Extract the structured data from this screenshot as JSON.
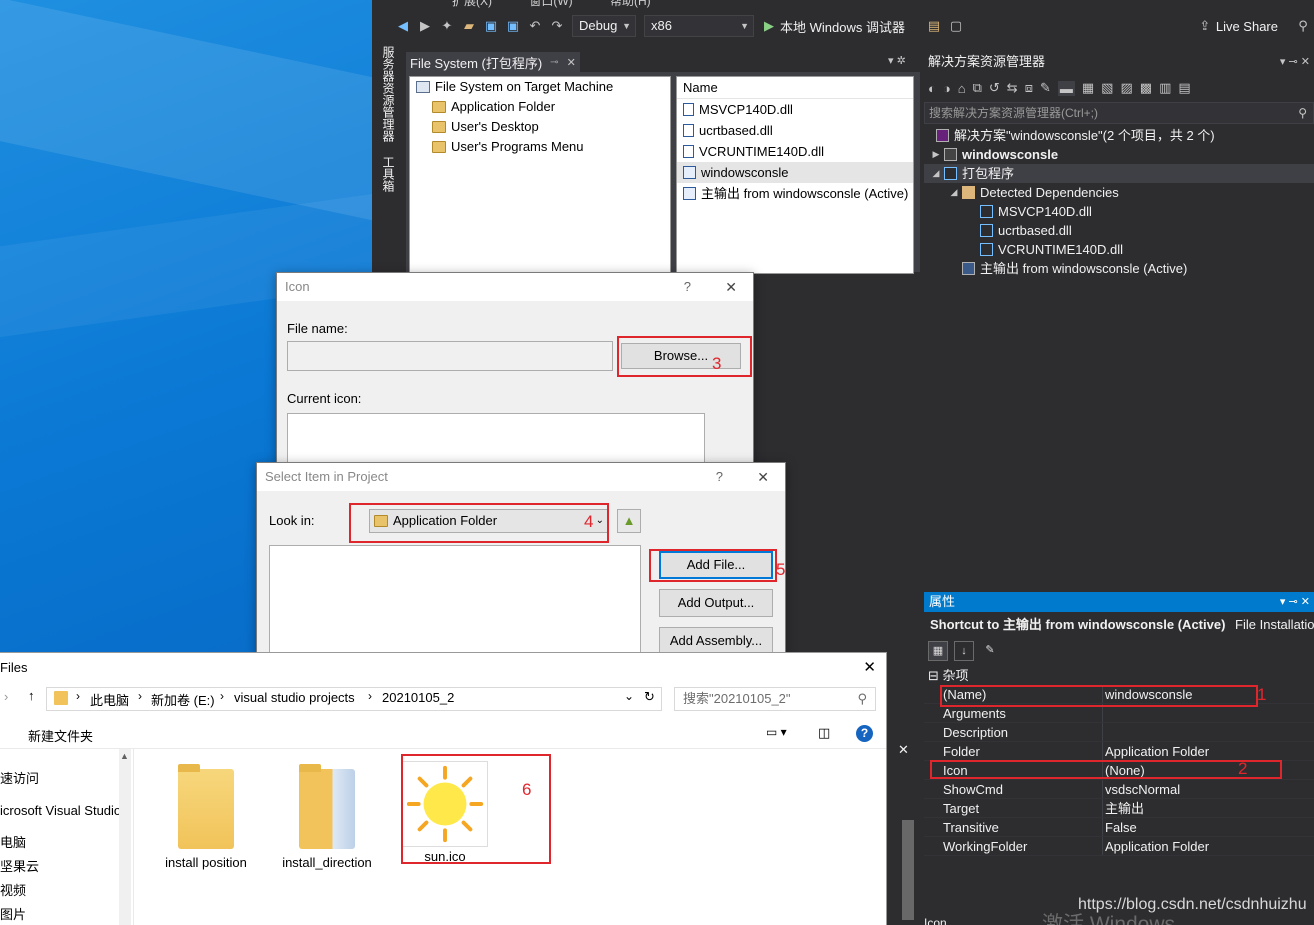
{
  "vs": {
    "menu_remnants": [
      "扩展(X)",
      "窗口(W)",
      "帮助(H)"
    ],
    "toolbar": {
      "config": "Debug",
      "platform": "x86",
      "run_label": "本地 Windows 调试器",
      "live_share": "Live Share"
    },
    "side_tabs": [
      "服务器资源管理器",
      "工具箱"
    ],
    "fs_window": {
      "tab_title": "File System (打包程序)",
      "tree": [
        "File System on Target Machine",
        "Application Folder",
        "User's Desktop",
        "User's Programs Menu"
      ],
      "list_header": "Name",
      "list_items": [
        "MSVCP140D.dll",
        "ucrtbased.dll",
        "VCRUNTIME140D.dll",
        "windowsconsle",
        "主输出 from windowsconsle (Active)"
      ]
    },
    "solution_explorer": {
      "title": "解决方案资源管理器",
      "search_placeholder": "搜索解决方案资源管理器(Ctrl+;)",
      "items": [
        "解决方案\"windowsconsle\"(2 个项目，共 2 个)",
        "windowsconsle",
        "打包程序",
        "Detected Dependencies",
        "MSVCP140D.dll",
        "ucrtbased.dll",
        "VCRUNTIME140D.dll",
        "主输出 from windowsconsle (Active)"
      ]
    },
    "properties": {
      "title": "属性",
      "object_name": "Shortcut to 主输出 from windowsconsle (Active)",
      "object_type": "File Installation",
      "category": "杂项",
      "rows": [
        {
          "k": "(Name)",
          "v": "windowsconsle"
        },
        {
          "k": "Arguments",
          "v": ""
        },
        {
          "k": "Description",
          "v": ""
        },
        {
          "k": "Folder",
          "v": "Application Folder"
        },
        {
          "k": "Icon",
          "v": "(None)"
        },
        {
          "k": "ShowCmd",
          "v": "vsdscNormal"
        },
        {
          "k": "Target",
          "v": "主输出"
        },
        {
          "k": "Transitive",
          "v": "False"
        },
        {
          "k": "WorkingFolder",
          "v": "Application Folder"
        }
      ],
      "footer_label": "Icon"
    }
  },
  "icon_dialog": {
    "title": "Icon",
    "help": "?",
    "close": "✕",
    "file_name_label": "File name:",
    "browse_button": "Browse...",
    "current_icon_label": "Current icon:"
  },
  "select_dialog": {
    "title": "Select Item in Project",
    "help": "?",
    "close": "✕",
    "look_in_label": "Look in:",
    "look_in_value": "Application Folder",
    "add_file_button": "Add File...",
    "add_output_button": "Add Output...",
    "add_assembly_button": "Add Assembly..."
  },
  "file_dialog": {
    "title": "Files",
    "close": "✕",
    "breadcrumb": [
      "此电脑",
      "新加卷 (E:)",
      "visual studio projects",
      "20210105_2"
    ],
    "search_placeholder": "搜索\"20210105_2\"",
    "new_folder": "新建文件夹",
    "nav": [
      "速访问",
      "icrosoft Visual Studio",
      "电脑",
      "坚果云",
      "视频",
      "图片"
    ],
    "files": [
      "install position",
      "install_direction",
      "sun.ico"
    ]
  },
  "annotations": [
    "1",
    "2",
    "3",
    "4",
    "5",
    "6"
  ],
  "watermark": {
    "url": "https://blog.csdn.net/csdnhuizhu",
    "activate": "激活 Windows"
  }
}
